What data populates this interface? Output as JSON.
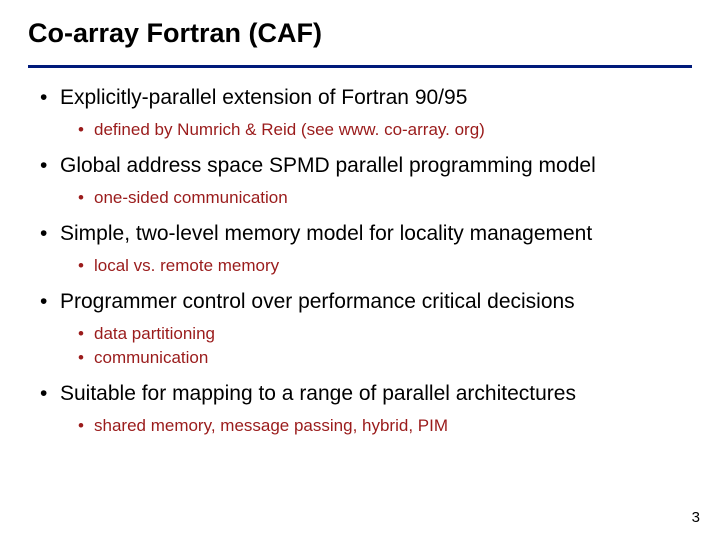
{
  "title": "Co-array Fortran (CAF)",
  "bullets": {
    "b1": "Explicitly-parallel extension of Fortran 90/95",
    "b1s1": "defined by Numrich & Reid (see www. co-array. org)",
    "b2": "Global address space SPMD parallel programming model",
    "b2s1": "one-sided communication",
    "b3": "Simple, two-level memory model for locality management",
    "b3s1": "local vs. remote memory",
    "b4": "Programmer control over performance critical decisions",
    "b4s1": "data partitioning",
    "b4s2": "communication",
    "b5": "Suitable for mapping to a range of parallel architectures",
    "b5s1": "shared memory, message passing, hybrid, PIM"
  },
  "page_number": "3"
}
